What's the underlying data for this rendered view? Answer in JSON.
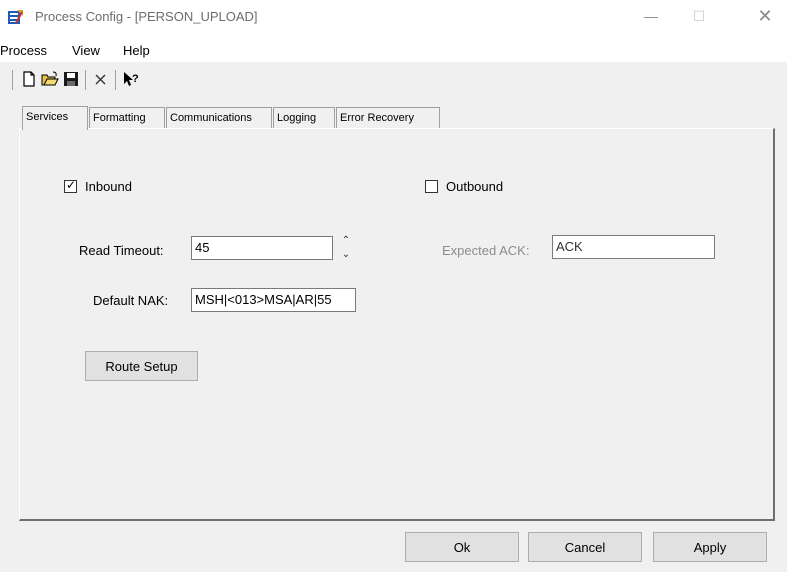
{
  "window": {
    "title": "Process Config - [PERSON_UPLOAD]",
    "minimize_glyph": "—",
    "maximize_glyph": "☐",
    "close_glyph": "✕"
  },
  "menu": {
    "items": [
      "Process",
      "View",
      "Help"
    ]
  },
  "toolbar": {
    "buttons": [
      "new-document-icon",
      "open-folder-icon",
      "save-icon",
      "delete-icon",
      "context-help-icon"
    ]
  },
  "tabs": {
    "items": [
      "Services",
      "Formatting",
      "Communications",
      "Logging",
      "Error Recovery"
    ],
    "active": "Services"
  },
  "services": {
    "inbound": {
      "label": "Inbound",
      "checked": true
    },
    "outbound": {
      "label": "Outbound",
      "checked": false
    },
    "read_timeout": {
      "label": "Read Timeout:",
      "value": "45"
    },
    "expected_ack": {
      "label": "Expected ACK:",
      "value": "ACK",
      "enabled": false
    },
    "default_nak": {
      "label": "Default NAK:",
      "value": "MSH|<013>MSA|AR|55"
    },
    "route_setup_label": "Route Setup"
  },
  "footer": {
    "ok_label": "Ok",
    "cancel_label": "Cancel",
    "apply_label": "Apply"
  }
}
